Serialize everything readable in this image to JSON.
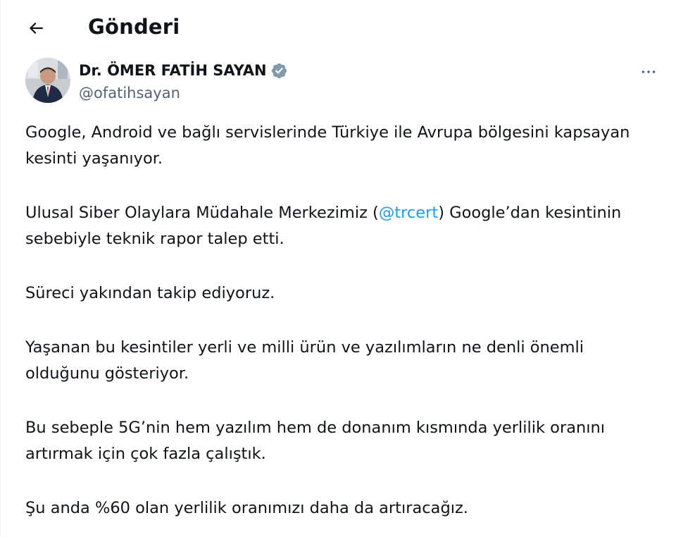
{
  "header": {
    "back_icon": "arrow-left-icon",
    "title": "Gönderi"
  },
  "author": {
    "name": "Dr. ÖMER FATİH SAYAN",
    "handle": "@ofatihsayan",
    "verified_icon": "verified-badge-icon",
    "verified_color": "#829aab",
    "more_icon": "more-horizontal-icon"
  },
  "tweet": {
    "paragraphs": [
      "Google, Android ve bağlı servislerinde Türkiye ile Avrupa bölgesini kapsayan kesinti yaşanıyor.",
      {
        "before": "Ulusal Siber Olaylara Müdahale Merkezimiz (",
        "mention": "@trcert",
        "after": ") Google’dan kesintinin sebebiyle teknik rapor talep etti."
      },
      "Süreci yakından takip ediyoruz.",
      "Yaşanan bu kesintiler yerli ve milli ürün ve yazılımların ne denli önemli olduğunu gösteriyor.",
      "Bu sebeple 5G’nin hem yazılım hem de donanım kısmında yerlilik oranını artırmak için çok fazla çalıştık.",
      "Şu anda %60 olan yerlilik oranımızı daha da artıracağız."
    ]
  },
  "colors": {
    "text": "#0f1419",
    "secondary": "#536471",
    "link": "#1d9bf0"
  }
}
